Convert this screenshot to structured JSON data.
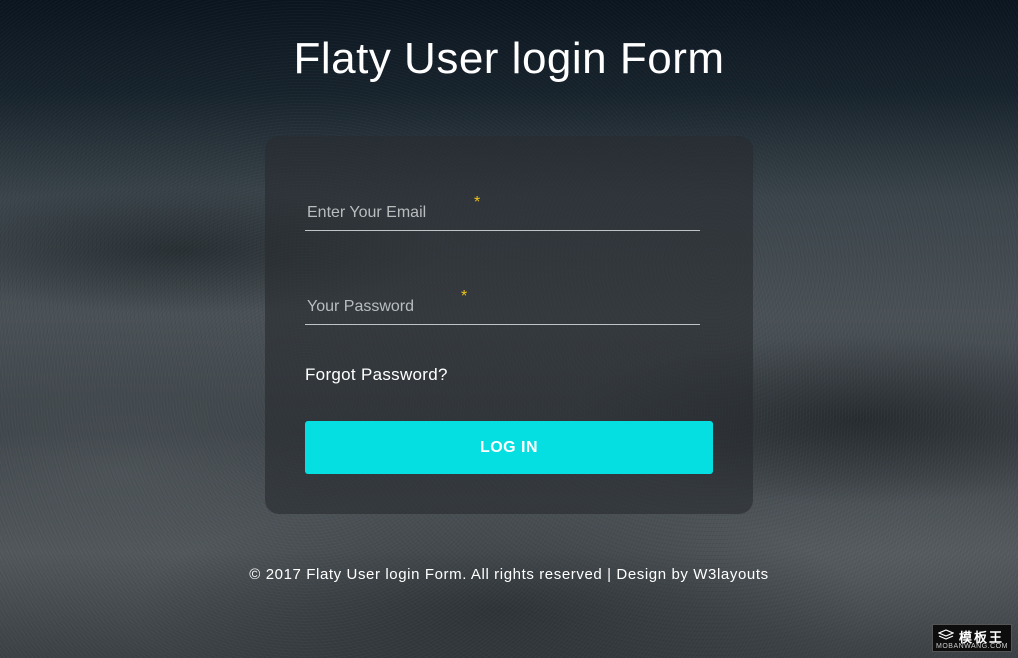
{
  "page": {
    "title": "Flaty User login Form"
  },
  "form": {
    "email": {
      "placeholder": "Enter Your Email",
      "required_marker": "*",
      "value": ""
    },
    "password": {
      "placeholder": "Your Password",
      "required_marker": "*",
      "value": ""
    },
    "forgot_link": "Forgot Password?",
    "submit_label": "LOG IN"
  },
  "footer": {
    "text": "© 2017 Flaty User login Form. All rights reserved | Design by W3layouts"
  },
  "watermark": {
    "cn": "模板王",
    "en": "MOBANWANG.COM",
    "icon": "stack-icon"
  },
  "colors": {
    "accent": "#06dfe2",
    "required": "#f0c419",
    "card": "rgba(40, 44, 48, 0.62)"
  }
}
